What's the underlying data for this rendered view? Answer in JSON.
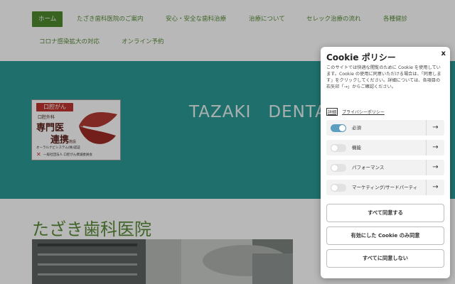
{
  "nav": {
    "items": [
      {
        "label": "ホーム",
        "active": true
      },
      {
        "label": "たざき歯科医院のご案内"
      },
      {
        "label": "安心・安全な歯科治療"
      },
      {
        "label": "治療について"
      },
      {
        "label": "セレック治療の流れ"
      },
      {
        "label": "各種健診"
      },
      {
        "label": "コロナ感染拡大の対応"
      },
      {
        "label": "オンライン予約"
      }
    ]
  },
  "hero": {
    "title": "TAZAKI　DENTA",
    "badge": {
      "top": "口腔がん",
      "line1": "口腔外科",
      "line2": "専門医",
      "line3": "連携",
      "line3_small": "施設",
      "line4": "オーラルナビシステム(株)認証",
      "line5": "一般社団法人 口腔がん撲滅委員会"
    }
  },
  "page": {
    "clinic_name": "たざき歯科医院"
  },
  "cookie": {
    "title": "Cookie ポリシー",
    "close": "x",
    "description": "このサイトでは快適な閲覧のために Cookie を使用しています。Cookie の使用に同意いただける場合は、「同意します」をクリックしてください。詳細については、各項目の右矢印「→」からご確認ください。",
    "details_link": "詳細",
    "privacy_link": "プライバシーポリシー",
    "categories": [
      {
        "label": "必須",
        "enabled": true
      },
      {
        "label": "機能",
        "enabled": false
      },
      {
        "label": "パフォーマンス",
        "enabled": false
      },
      {
        "label": "マーケティング/サードパーティ",
        "enabled": false
      }
    ],
    "arrow": "→",
    "buttons": {
      "accept_all": "すべて同意する",
      "accept_enabled": "有効にした Cookie のみ同意",
      "reject_all": "すべてに同意しない"
    }
  },
  "colors": {
    "brand_green": "#5b8d3a",
    "hero_teal": "#2c9c98",
    "toggle_on": "#5d9fc0"
  }
}
